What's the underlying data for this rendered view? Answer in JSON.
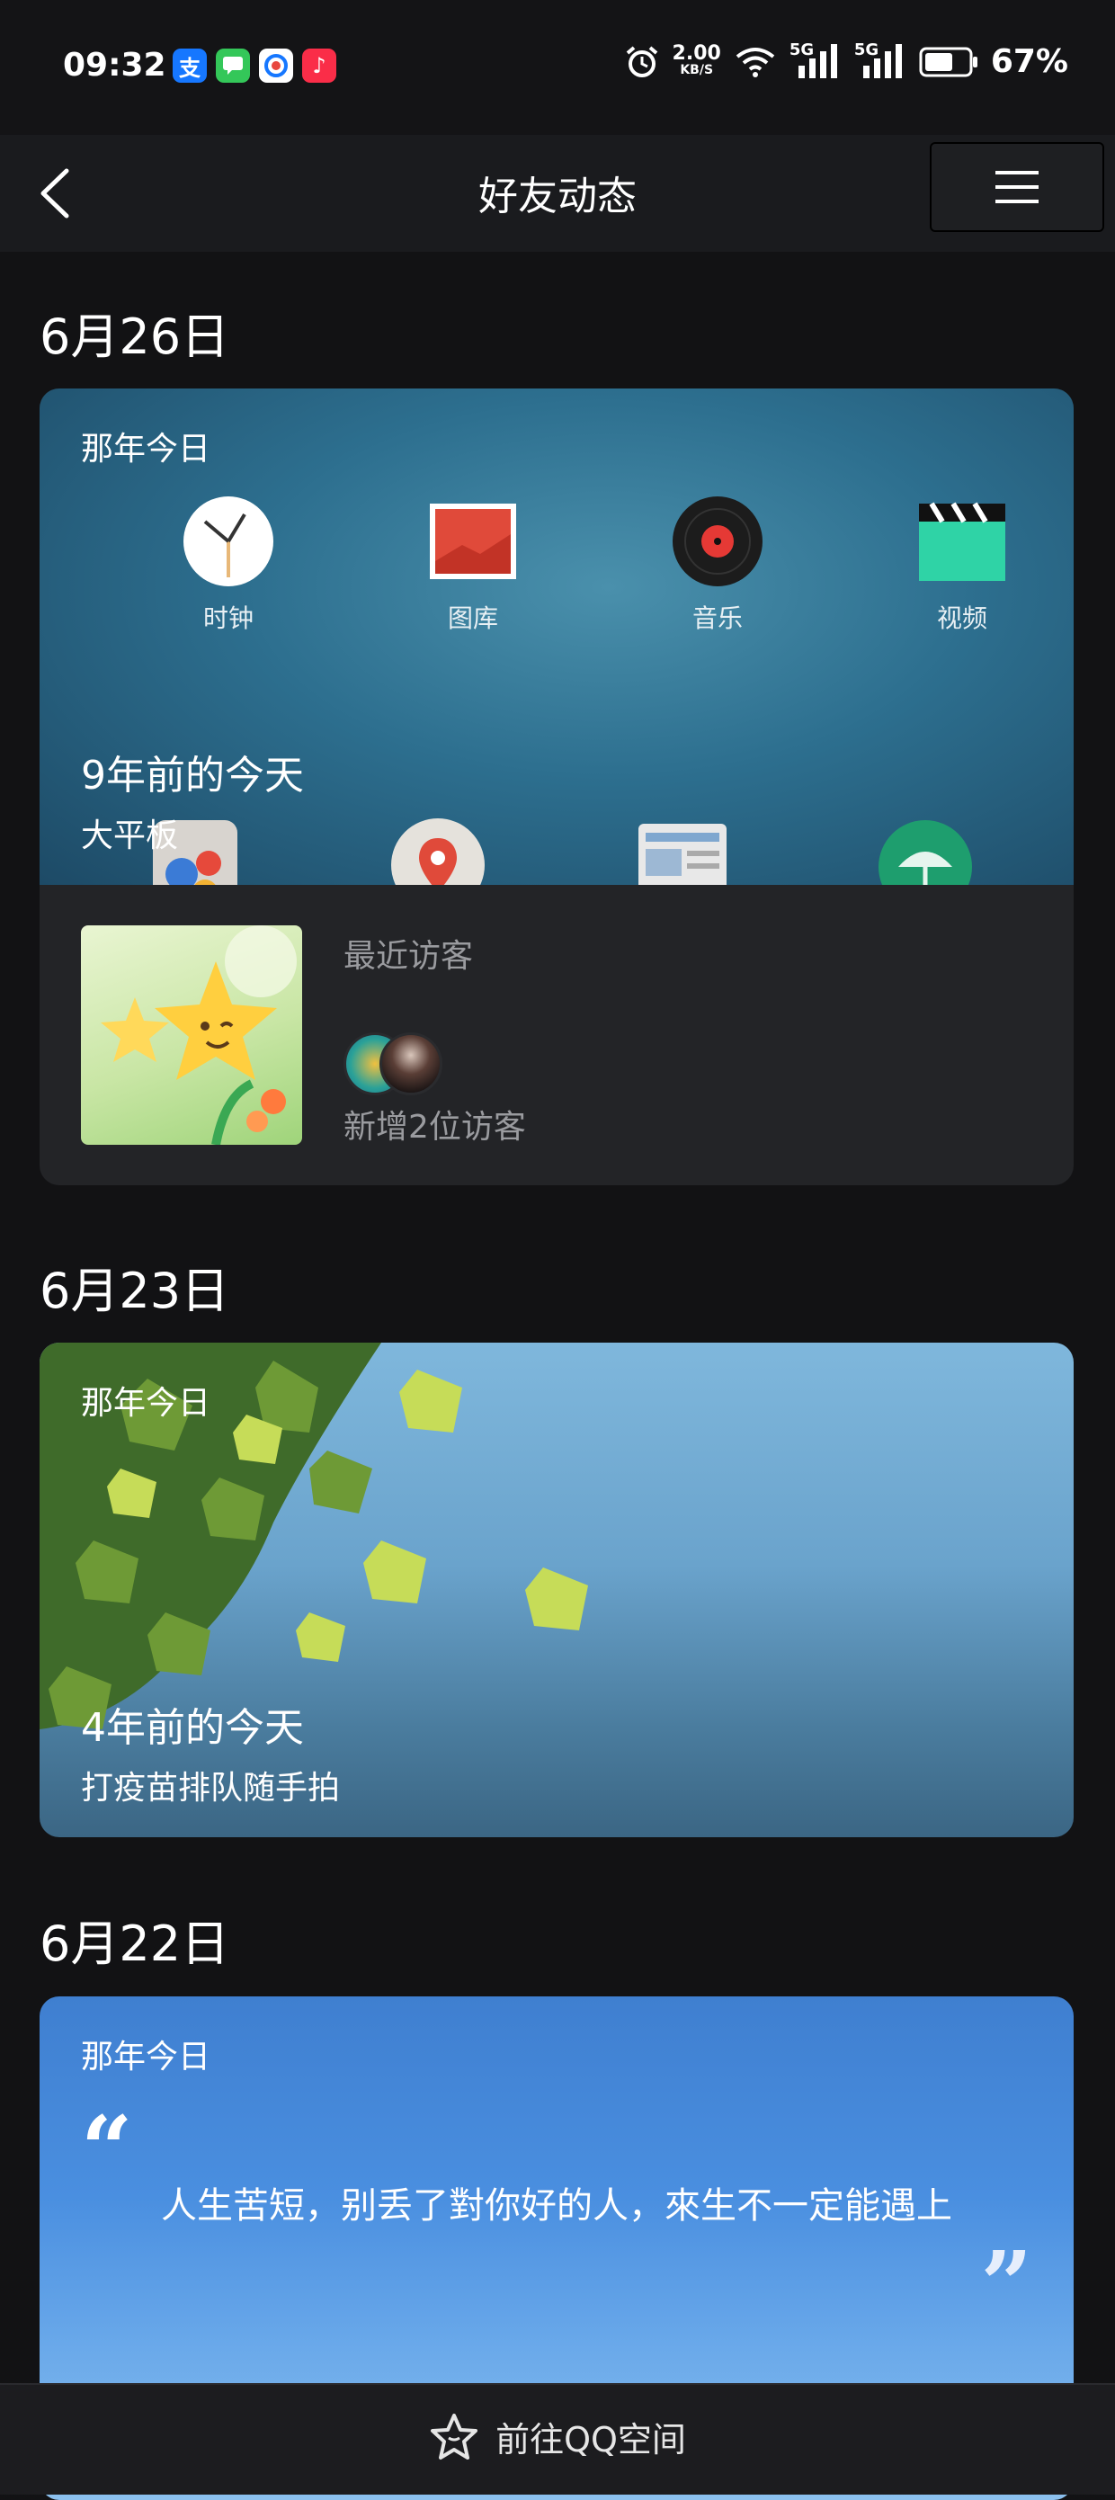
{
  "status_bar": {
    "time": "09:32",
    "apps": [
      {
        "icon": "alipay-icon",
        "glyph": "支",
        "color": "#1677ff"
      },
      {
        "icon": "messages-icon",
        "glyph": "",
        "color": "#34c759"
      },
      {
        "icon": "browser-icon",
        "glyph": "",
        "color": "#ffffff"
      },
      {
        "icon": "music-icon",
        "glyph": "♪",
        "color": "#fa2d48"
      }
    ],
    "speed_value": "2.00",
    "speed_unit": "KB/S",
    "network_1": "5G",
    "network_2": "5G",
    "battery": "67%"
  },
  "header": {
    "title": "好友动态",
    "back_icon": "chevron-left-icon",
    "menu_icon": "hamburger-menu-icon"
  },
  "feed": [
    {
      "date": "6月26日",
      "card_label": "那年今日",
      "apps": [
        "时钟",
        "图库",
        "音乐",
        "视频"
      ],
      "years_ago": "9年前的今天",
      "caption": "大平板",
      "visitors": {
        "title": "最近访客",
        "count_text": "新增2位访客"
      }
    },
    {
      "date": "6月23日",
      "card_label": "那年今日",
      "years_ago": "4年前的今天",
      "caption": "打疫苗排队随手拍"
    },
    {
      "date": "6月22日",
      "card_label": "那年今日",
      "quote_open": "“",
      "quote": "人生苦短，别丢了對你好的人，來生不一定能遇上",
      "quote_close": "”"
    }
  ],
  "bottom": {
    "icon": "star-icon",
    "label": "前往QQ空间"
  },
  "colors": {
    "background": "#121214",
    "header": "#1a1b1e",
    "muted_text": "#9a9b9f",
    "accent_blue": "#3f7fd0"
  }
}
